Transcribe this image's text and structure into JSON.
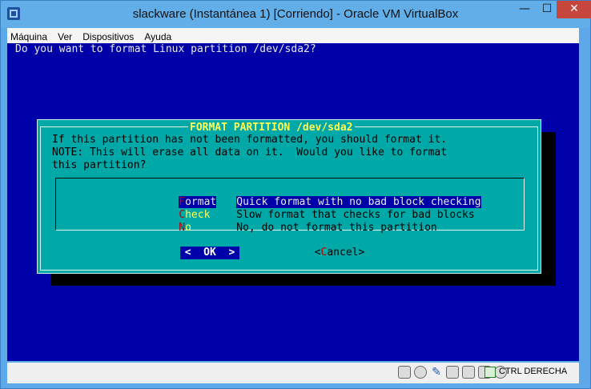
{
  "window": {
    "title": "slackware (Instantánea 1) [Corriendo] - Oracle VM VirtualBox",
    "minimize": "—",
    "maximize": "☐",
    "close": "✕"
  },
  "menubar": {
    "items": [
      "Máquina",
      "Ver",
      "Dispositivos",
      "Ayuda"
    ]
  },
  "screen": {
    "prompt": "Do you want to format Linux partition /dev/sda2?"
  },
  "dialog": {
    "title": "FORMAT PARTITION /dev/sda2",
    "text": "If this partition has not been formatted, you should format it.\nNOTE: This will erase all data on it.  Would you like to format\nthis partition?",
    "options": [
      {
        "hot": "F",
        "rest": "ormat",
        "desc": "Quick format with no bad block checking",
        "selected": true
      },
      {
        "hot": "C",
        "rest": "heck",
        "desc": "Slow format that checks for bad blocks",
        "selected": false
      },
      {
        "hot": "N",
        "rest": "o",
        "desc": "No, do not format this partition",
        "selected": false
      }
    ],
    "ok_label": "<  OK  >",
    "cancel": {
      "left": "<",
      "hot": "C",
      "rest": "ancel",
      "right": ">"
    }
  },
  "statusbar": {
    "host_key": "CTRL DERECHA",
    "icons": [
      "hard-disk-icon",
      "optical-disk-icon",
      "usb-icon",
      "shared-folders-icon",
      "display-icon",
      "video-capture-icon",
      "network-icon",
      "host-key-icon"
    ]
  },
  "colors": {
    "console_bg": "#0000a8",
    "dialog_bg": "#00a8a8",
    "title_text": "#ffff55",
    "hotkey": "#c00000"
  }
}
